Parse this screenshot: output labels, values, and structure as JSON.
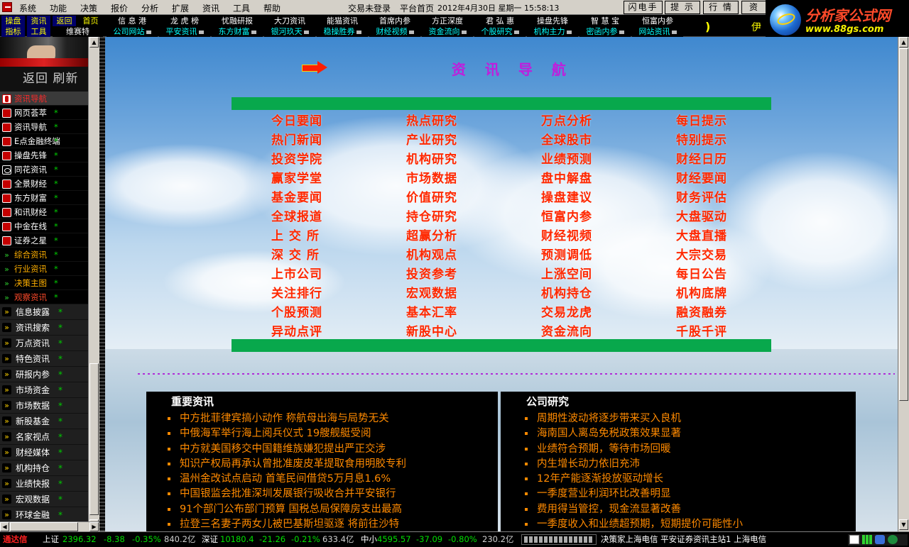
{
  "menubar": {
    "items": [
      "系统",
      "功能",
      "决策",
      "报价",
      "分析",
      "扩展",
      "资讯",
      "工具",
      "帮助"
    ],
    "login_status": "交易未登录",
    "platform_home": "平台首页",
    "datetime": "2012年4月30日 星期一  15:58:13",
    "buttons": [
      "闪电手",
      "提 示",
      "行 情",
      "资"
    ]
  },
  "logo": {
    "title": "分析家公式网",
    "url": "www.88gs.com"
  },
  "toolbar": {
    "left_top": [
      "操盘",
      "资讯",
      "返回",
      "首页"
    ],
    "left_bottom": [
      "指标",
      "工具",
      "维赛特"
    ],
    "top": [
      "信 息 港",
      "龙 虎 榜",
      "忧融研报",
      "大刀资讯",
      "能猫资讯",
      "首席内参",
      "方正深度",
      "君 弘 惠",
      "操盘先锋",
      "智 慧 宝",
      "恒富内参"
    ],
    "bottom": [
      "公司网站",
      "平安资讯",
      "东方财富",
      "银河玖天",
      "稳操胜券",
      "财经视频",
      "资金流向",
      "个股研究",
      "机构主力",
      "密函内参",
      "网站资讯"
    ],
    "trailing_bracket": ")",
    "trailing_char": "伊"
  },
  "sidebar": {
    "nav_label": "返回 刷新",
    "items": [
      {
        "label": "资讯导航",
        "mark": "",
        "icon": "pin-icon",
        "style": "sel"
      },
      {
        "label": "网页荟萃",
        "mark": "*",
        "icon": "red-badge-icon",
        "style": ""
      },
      {
        "label": "资讯导航",
        "mark": "*",
        "icon": "red-badge-icon",
        "style": ""
      },
      {
        "label": "E点金融终端",
        "mark": "*",
        "icon": "red-badge-icon",
        "style": ""
      },
      {
        "label": "操盘先锋",
        "mark": "*",
        "icon": "red-badge-icon",
        "style": ""
      },
      {
        "label": "同花资讯",
        "mark": "*",
        "icon": "tv-icon",
        "style": ""
      },
      {
        "label": "全景财经",
        "mark": "*",
        "icon": "red-badge-icon",
        "style": ""
      },
      {
        "label": "东方财富",
        "mark": "*",
        "icon": "red-badge-icon",
        "style": ""
      },
      {
        "label": "和讯财经",
        "mark": "*",
        "icon": "red-badge-icon",
        "style": ""
      },
      {
        "label": "中金在线",
        "mark": "*",
        "icon": "red-badge-icon",
        "style": ""
      },
      {
        "label": "证券之星",
        "mark": "*",
        "icon": "red-badge-icon",
        "style": ""
      },
      {
        "label": "综合资讯",
        "mark": "*",
        "icon": "arrow-icon",
        "style": "gold"
      },
      {
        "label": "行业资讯",
        "mark": "*",
        "icon": "arrow-icon",
        "style": "gold"
      },
      {
        "label": "决策主图",
        "mark": "*",
        "icon": "arrow-icon",
        "style": "gold"
      },
      {
        "label": "观察资讯",
        "mark": "*",
        "icon": "arrow-icon",
        "style": "red"
      }
    ],
    "big_items": [
      {
        "label": "信息披露",
        "mark": "*"
      },
      {
        "label": "资讯搜索",
        "mark": "*"
      },
      {
        "label": "万点资讯",
        "mark": "*"
      },
      {
        "label": "特色资讯",
        "mark": "*"
      },
      {
        "label": "研报内参",
        "mark": "*"
      },
      {
        "label": "市场资金",
        "mark": "*"
      },
      {
        "label": "市场数据",
        "mark": "*"
      },
      {
        "label": "新股基金",
        "mark": "*"
      },
      {
        "label": "名家视点",
        "mark": "*"
      },
      {
        "label": "财经媒体",
        "mark": "*"
      },
      {
        "label": "机构持仓",
        "mark": "*"
      },
      {
        "label": "业绩快报",
        "mark": "*"
      },
      {
        "label": "宏观数据",
        "mark": "*"
      },
      {
        "label": "环球金融",
        "mark": "*"
      }
    ]
  },
  "main": {
    "nav_title": "资 讯 导 航",
    "links": [
      [
        "今日要闻",
        "热点研究",
        "万点分析",
        "每日提示"
      ],
      [
        "热门新闻",
        "产业研究",
        "全球股市",
        "特别提示"
      ],
      [
        "投资学院",
        "机构研究",
        "业绩预测",
        "财经日历"
      ],
      [
        "赢家学堂",
        "市场数据",
        "盘中解盘",
        "财经要闻"
      ],
      [
        "基金要闻",
        "价值研究",
        "操盘建议",
        "财务评估"
      ],
      [
        "全球报道",
        "持仓研究",
        "恒富内参",
        "大盘驱动"
      ],
      [
        "上 交 所",
        "超赢分析",
        "财经视频",
        "大盘直播"
      ],
      [
        "深 交 所",
        "机构观点",
        "预测调低",
        "大宗交易"
      ],
      [
        "上市公司",
        "投资参考",
        "上涨空间",
        "每日公告"
      ],
      [
        "关注排行",
        "宏观数据",
        "机构持仓",
        "机构底牌"
      ],
      [
        "个股预测",
        "基本汇率",
        "交易龙虎",
        "融资融券"
      ],
      [
        "异动点评",
        "新股中心",
        "资金流向",
        "千股千评"
      ]
    ],
    "news_left": {
      "title": "重要资讯",
      "items": [
        "中方批菲律宾搞小动作 称航母出海与局势无关",
        "中俄海军举行海上阅兵仪式 19艘舰艇受阅",
        "中方就美国移交中国籍维族嫌犯提出严正交涉",
        "知识产权局再承认曾批准废皮革提取食用明胶专利",
        "温州金改试点启动 首笔民间借贷5万月息1.6%",
        "中国银监会批准深圳发展银行吸收合并平安银行",
        "91个部门公布部门预算 国税总局保障房支出最高",
        "拉登三名妻子两女儿被巴基斯坦驱逐 将前往沙特"
      ]
    },
    "news_right": {
      "title": "公司研究",
      "items": [
        "周期性波动将逐步带来买入良机",
        "海南国人离岛免税政策效果显著",
        "业绩符合预期，等待市场回暖",
        "内生增长动力依旧充沛",
        "12年产能逐渐投放驱动增长",
        "一季度营业利润环比改善明显",
        "费用得当管控，现金流显著改善",
        "一季度收入和业绩超预期，短期提价可能性小"
      ]
    }
  },
  "statusbar": {
    "brand": "通达信",
    "sh_label": "上证",
    "sh_value": "2396.32",
    "sh_change": "-8.38",
    "sh_pct": "-0.35%",
    "sh_amount": "840.2亿",
    "sz_label": "深证",
    "sz_value": "10180.4",
    "sz_change": "-21.26",
    "sz_pct": "-0.21%",
    "sz_amount": "633.4亿",
    "zx_label": "中小",
    "zx_value": "4595.57",
    "zx_change": "-37.09",
    "zx_pct": "-0.80%",
    "zx_amount": "230.2亿",
    "server_info": "决策家上海电信  平安证券资讯主站1 上海电信"
  },
  "colors": {
    "link_red": "#ff2800",
    "news_orange": "#ff8a00",
    "title_purple": "#c01ddc",
    "bar_green": "#08a84c"
  }
}
